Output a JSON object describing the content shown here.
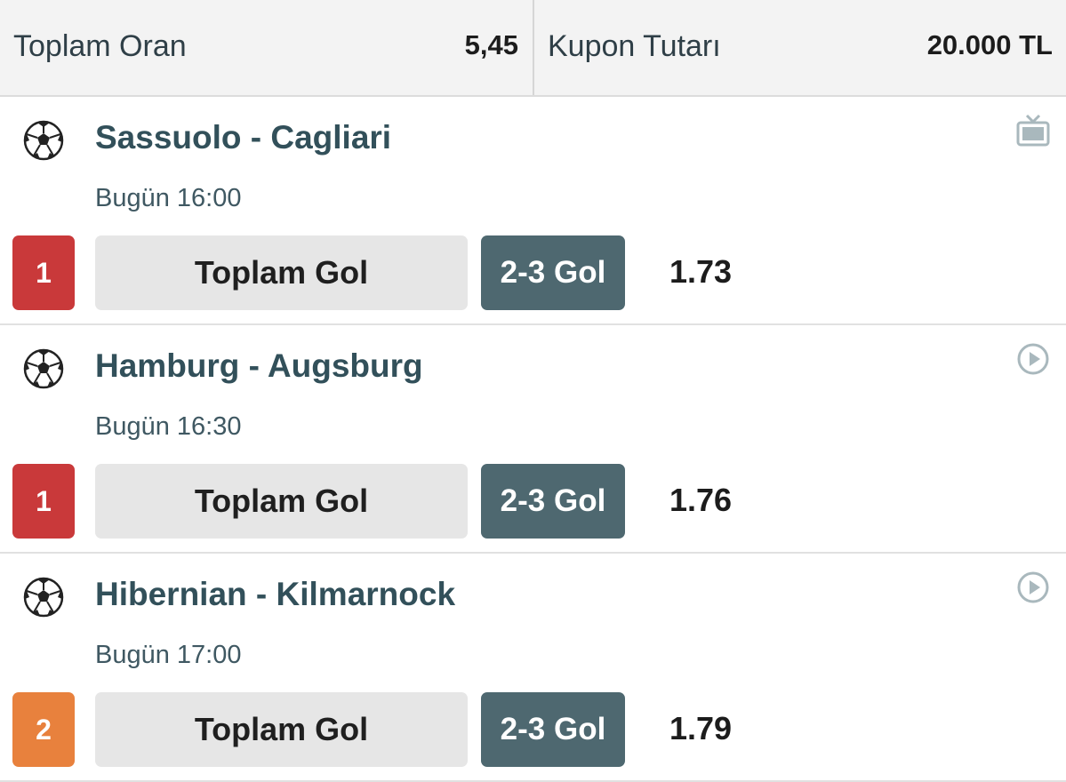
{
  "summary": {
    "total_odds_label": "Toplam Oran",
    "total_odds_value": "5,45",
    "coupon_amount_label": "Kupon Tutarı",
    "coupon_amount_value": "20.000 TL"
  },
  "matches": [
    {
      "teams": "Sassuolo - Cagliari",
      "time": "Bugün 16:00",
      "pick": "1",
      "pick_color": "#c9393a",
      "market": "Toplam Gol",
      "selection": "2-3 Gol",
      "odd": "1.73",
      "status_icon": "tv-icon"
    },
    {
      "teams": "Hamburg - Augsburg",
      "time": "Bugün 16:30",
      "pick": "1",
      "pick_color": "#c9393a",
      "market": "Toplam Gol",
      "selection": "2-3 Gol",
      "odd": "1.76",
      "status_icon": "play-circle-icon"
    },
    {
      "teams": "Hibernian - Kilmarnock",
      "time": "Bugün 17:00",
      "pick": "2",
      "pick_color": "#e8813d",
      "market": "Toplam Gol",
      "selection": "2-3 Gol",
      "odd": "1.79",
      "status_icon": "play-circle-icon"
    }
  ],
  "colors": {
    "header_bg": "#f3f3f3",
    "team_text": "#32505a",
    "selection_bg": "#4e6870",
    "market_bg": "#e6e6e6"
  }
}
